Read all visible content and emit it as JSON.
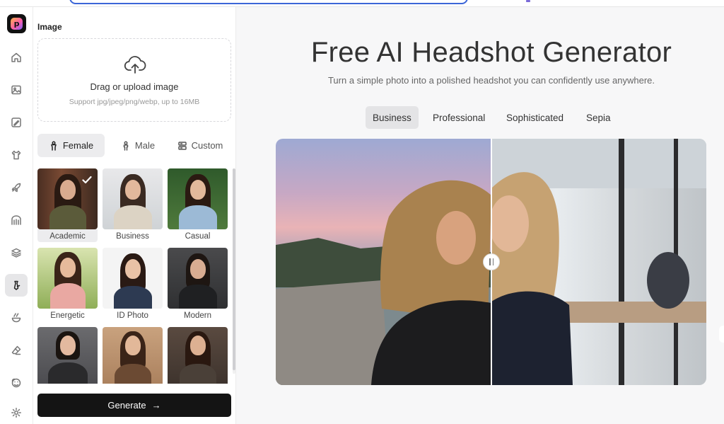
{
  "panel": {
    "section_label": "Image",
    "upload": {
      "title": "Drag or upload image",
      "hint": "Support jpg/jpeg/png/webp, up to 16MB"
    },
    "gender_tabs": [
      {
        "label": "Female",
        "icon": "female-icon",
        "selected": true
      },
      {
        "label": "Male",
        "icon": "male-icon",
        "selected": false
      },
      {
        "label": "Custom",
        "icon": "custom-layout-icon",
        "selected": false
      }
    ],
    "styles": [
      {
        "label": "Academic",
        "selected": true
      },
      {
        "label": "Business",
        "selected": false
      },
      {
        "label": "Casual",
        "selected": false
      },
      {
        "label": "Energetic",
        "selected": false
      },
      {
        "label": "ID Photo",
        "selected": false
      },
      {
        "label": "Modern",
        "selected": false
      },
      {
        "label": "",
        "selected": false
      },
      {
        "label": "",
        "selected": false
      },
      {
        "label": "",
        "selected": false
      }
    ],
    "generate_label": "Generate",
    "generate_arrow": "→"
  },
  "main": {
    "title": "Free AI Headshot Generator",
    "subtitle": "Turn a simple photo into a polished headshot you can confidently use anywhere.",
    "tabs": [
      {
        "label": "Business",
        "selected": true
      },
      {
        "label": "Professional",
        "selected": false
      },
      {
        "label": "Sophisticated",
        "selected": false
      },
      {
        "label": "Sepia",
        "selected": false
      }
    ]
  },
  "rail": {
    "logo_letter": "p",
    "icons": [
      "home-icon",
      "image-icon",
      "edit-image-icon",
      "outfit-icon",
      "rocket-icon",
      "archway-icon",
      "layers-icon",
      "tie-icon",
      "bowl-icon",
      "eraser-icon",
      "face-scan-icon",
      "settings-icon"
    ],
    "active_icon": "tie-icon"
  },
  "colors": {
    "accent": "#141414",
    "selected_bg": "#ececee",
    "url_border": "#3c66d8"
  }
}
